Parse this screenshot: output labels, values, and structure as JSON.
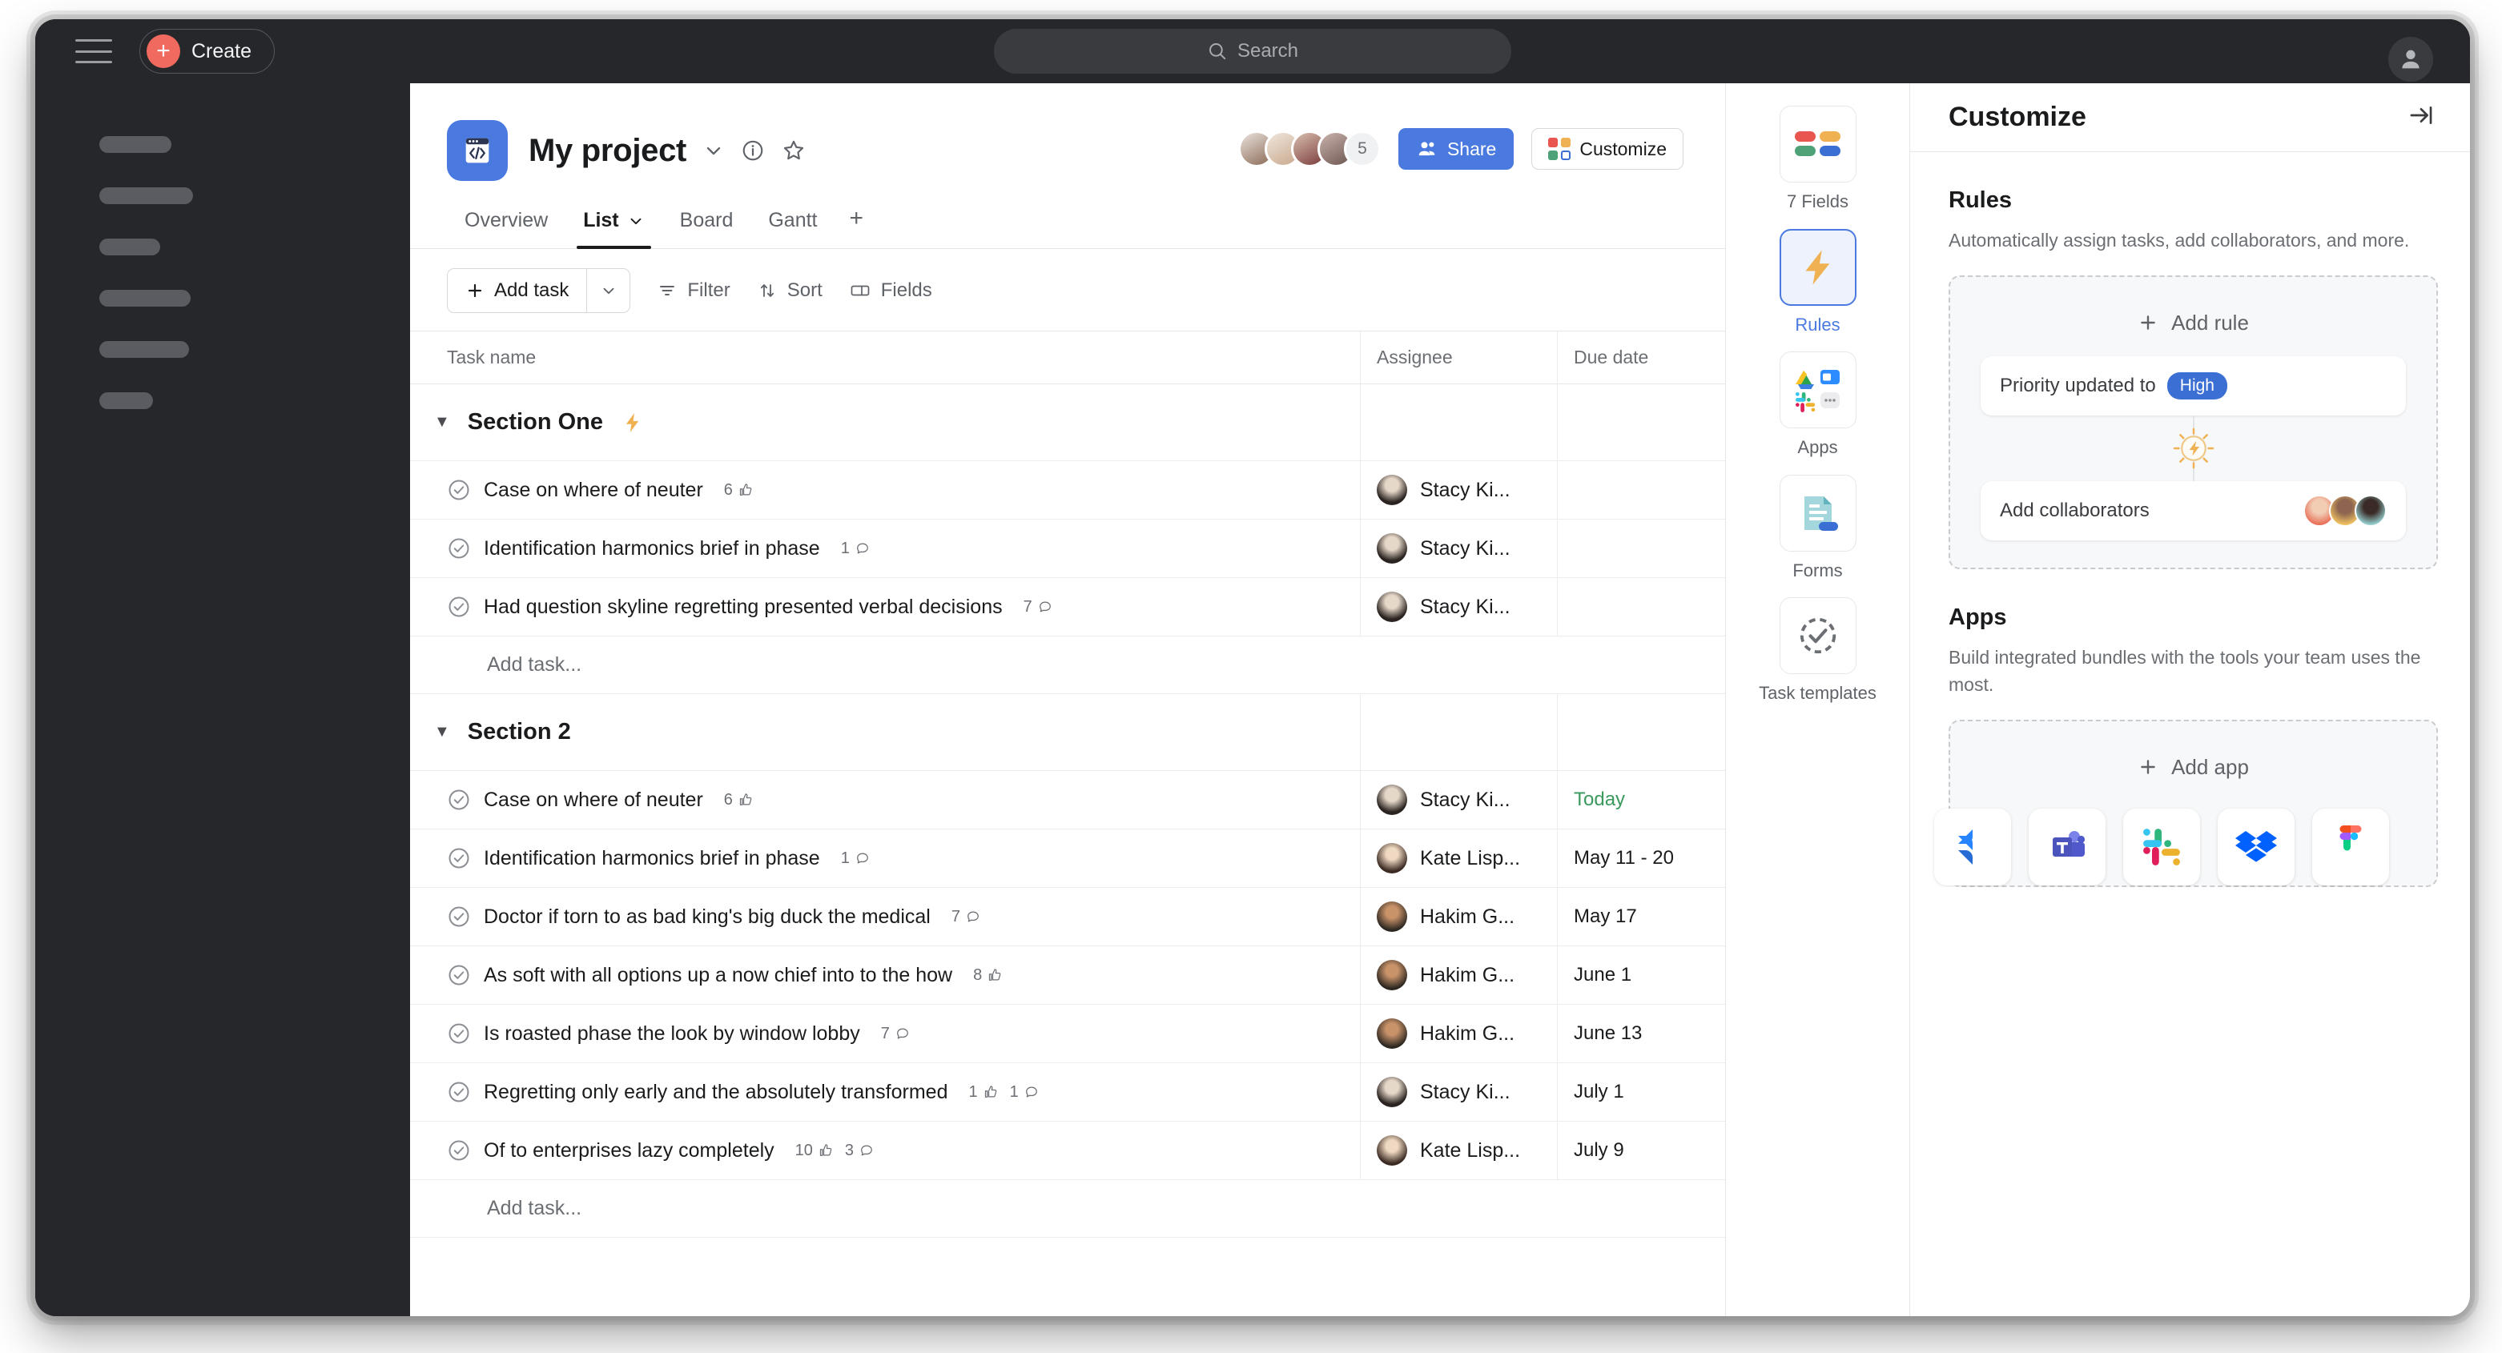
{
  "topbar": {
    "menu_icon": "hamburger-icon",
    "create_label": "Create",
    "search_placeholder": "Search",
    "search_icon": "search-icon",
    "profile_icon": "person-icon"
  },
  "sidebar": {
    "skeleton_widths": [
      90,
      117,
      76,
      114,
      112,
      67
    ]
  },
  "project": {
    "title": "My project",
    "icon": "code-window-icon",
    "chevron_icon": "chevron-down-icon",
    "info_icon": "info-circle-icon",
    "star_icon": "star-icon",
    "members_overflow": "5",
    "share_label": "Share",
    "share_icon": "people-icon",
    "customize_label": "Customize",
    "customize_icon": "grid-color-icon",
    "accent_blue": "#4a7ae0"
  },
  "tabs": [
    {
      "label": "Overview",
      "active": false,
      "caret": false
    },
    {
      "label": "List",
      "active": true,
      "caret": true
    },
    {
      "label": "Board",
      "active": false,
      "caret": false
    },
    {
      "label": "Gantt",
      "active": false,
      "caret": false
    }
  ],
  "tab_add_label": "+",
  "toolbar": {
    "add_task_label": "Add task",
    "add_task_caret_icon": "chevron-down-icon",
    "filter_label": "Filter",
    "filter_icon": "filter-icon",
    "sort_label": "Sort",
    "sort_icon": "sort-arrows-icon",
    "fields_label": "Fields",
    "fields_icon": "fields-icon"
  },
  "table": {
    "columns": [
      "Task name",
      "Assignee",
      "Due date"
    ],
    "add_task_placeholder": "Add task...",
    "sections": [
      {
        "title": "Section One",
        "badge_icon": "lightning-icon",
        "has_badge": true,
        "rows": [
          {
            "name": "Case on where of neuter",
            "meta": [
              {
                "count": "6",
                "icon": "thumbs-up-icon"
              }
            ],
            "assignee": "Stacy Ki...",
            "avatar": "stacy",
            "due": "",
            "due_today": false
          },
          {
            "name": "Identification harmonics brief in phase",
            "meta": [
              {
                "count": "1",
                "icon": "comment-icon"
              }
            ],
            "assignee": "Stacy Ki...",
            "avatar": "stacy",
            "due": "",
            "due_today": false
          },
          {
            "name": "Had question skyline regretting presented verbal decisions",
            "meta": [
              {
                "count": "7",
                "icon": "comment-icon"
              }
            ],
            "assignee": "Stacy Ki...",
            "avatar": "stacy",
            "due": "",
            "due_today": false
          }
        ]
      },
      {
        "title": "Section 2",
        "badge_icon": "",
        "has_badge": false,
        "rows": [
          {
            "name": "Case on where of neuter",
            "meta": [
              {
                "count": "6",
                "icon": "thumbs-up-icon"
              }
            ],
            "assignee": "Stacy Ki...",
            "avatar": "stacy",
            "due": "Today",
            "due_today": true
          },
          {
            "name": "Identification harmonics brief in phase",
            "meta": [
              {
                "count": "1",
                "icon": "comment-icon"
              }
            ],
            "assignee": "Kate Lisp...",
            "avatar": "kate",
            "due": "May 11 - 20",
            "due_today": false
          },
          {
            "name": "Doctor if torn to as bad king's big duck the medical",
            "meta": [
              {
                "count": "7",
                "icon": "comment-icon"
              }
            ],
            "assignee": "Hakim G...",
            "avatar": "hakim",
            "due": "May 17",
            "due_today": false
          },
          {
            "name": "As soft with all options up a now chief into to the how",
            "meta": [
              {
                "count": "8",
                "icon": "thumbs-up-icon"
              }
            ],
            "assignee": "Hakim G...",
            "avatar": "hakim",
            "due": "June 1",
            "due_today": false
          },
          {
            "name": "Is roasted phase the look by window lobby",
            "meta": [
              {
                "count": "7",
                "icon": "comment-icon"
              }
            ],
            "assignee": "Hakim G...",
            "avatar": "hakim",
            "due": "June 13",
            "due_today": false
          },
          {
            "name": "Regretting only early and the absolutely transformed",
            "meta": [
              {
                "count": "1",
                "icon": "thumbs-up-icon"
              },
              {
                "count": "1",
                "icon": "comment-icon"
              }
            ],
            "assignee": "Stacy Ki...",
            "avatar": "stacy",
            "due": "July 1",
            "due_today": false
          },
          {
            "name": "Of to enterprises lazy completely",
            "meta": [
              {
                "count": "10",
                "icon": "thumbs-up-icon"
              },
              {
                "count": "3",
                "icon": "comment-icon"
              }
            ],
            "assignee": "Kate Lisp...",
            "avatar": "kate",
            "due": "July 9",
            "due_today": false
          }
        ]
      }
    ]
  },
  "rail": [
    {
      "label": "7 Fields",
      "icon": "fields-color-icon",
      "active": false
    },
    {
      "label": "Rules",
      "icon": "lightning-icon",
      "active": true
    },
    {
      "label": "Apps",
      "icon": "apps-grid-icon",
      "active": false
    },
    {
      "label": "Forms",
      "icon": "form-doc-icon",
      "active": false
    },
    {
      "label": "Task templates",
      "icon": "dashed-check-icon",
      "active": false
    }
  ],
  "customize": {
    "title": "Customize",
    "collapse_icon": "collapse-right-icon",
    "rules": {
      "heading": "Rules",
      "description": "Automatically assign tasks, add collaborators, and more.",
      "add_label": "Add rule",
      "add_icon": "plus-icon",
      "trigger_text": "Priority updated to",
      "trigger_pill": "High",
      "pill_color": "#3b6fd4",
      "connector_icon": "lightning-burst-icon",
      "action_text": "Add collaborators"
    },
    "apps": {
      "heading": "Apps",
      "description": "Build integrated bundles with the tools your team uses the most.",
      "add_label": "Add app",
      "add_icon": "plus-icon",
      "tiles": [
        "jira-icon",
        "microsoft-teams-icon",
        "slack-icon",
        "dropbox-icon",
        "figma-icon"
      ]
    }
  }
}
